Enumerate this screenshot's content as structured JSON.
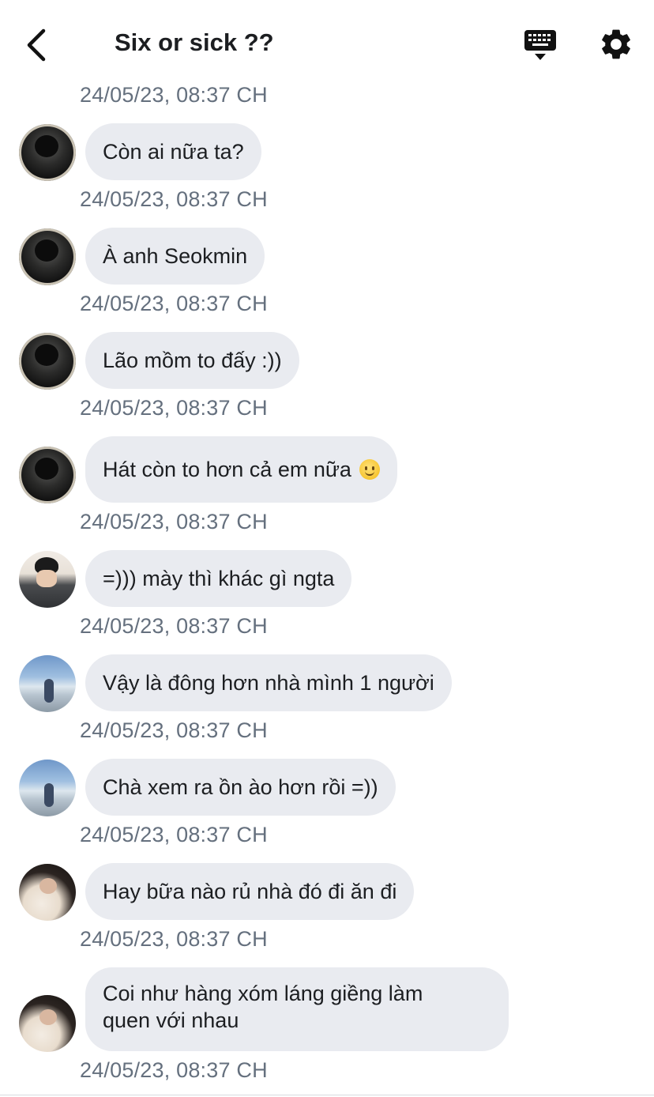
{
  "header": {
    "title": "Six or sick ??"
  },
  "messages": [
    {
      "timestamp": "24/05/23, 08:37 CH"
    },
    {
      "avatar": "avatar-dark-hood",
      "text": "Còn ai nữa ta?",
      "timestamp": "24/05/23, 08:37 CH"
    },
    {
      "avatar": "avatar-dark-hood",
      "text": "À anh Seokmin",
      "timestamp": "24/05/23, 08:37 CH"
    },
    {
      "avatar": "avatar-dark-hood",
      "text": "Lão mồm to đấy :))",
      "timestamp": "24/05/23, 08:37 CH"
    },
    {
      "avatar": "avatar-dark-hood",
      "text": "Hát còn to hơn cả em nữa",
      "emoji": "slightly-smiling-face",
      "timestamp": "24/05/23, 08:37 CH"
    },
    {
      "avatar": "avatar-boy-selfie",
      "text": "=))) mày thì khác gì ngta",
      "timestamp": "24/05/23, 08:37 CH"
    },
    {
      "avatar": "avatar-beach",
      "text": "Vậy là đông hơn nhà mình 1 người",
      "timestamp": "24/05/23, 08:37 CH"
    },
    {
      "avatar": "avatar-beach",
      "text": "Chà xem ra ồn ào hơn rồi =))",
      "timestamp": "24/05/23, 08:37 CH"
    },
    {
      "avatar": "avatar-girl",
      "text": "Hay bữa nào rủ nhà đó đi ăn đi",
      "timestamp": "24/05/23, 08:37 CH"
    },
    {
      "avatar": "avatar-girl",
      "text": "Coi như hàng xóm láng giềng làm\nquen với nhau",
      "timestamp": "24/05/23, 08:37 CH"
    }
  ]
}
